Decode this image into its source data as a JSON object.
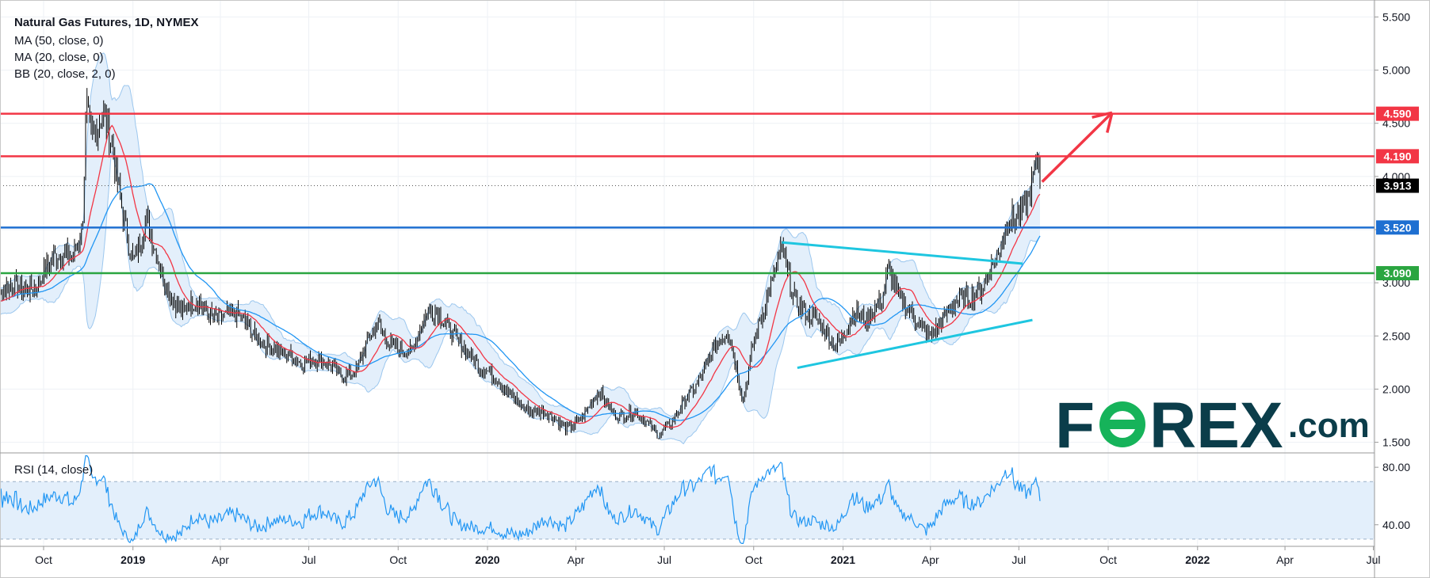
{
  "chart_data": [
    {
      "type": "candlestick",
      "title": "Natural Gas Futures, 1D, NYMEX",
      "legend": [
        "MA (50, close, 0)",
        "MA (20, close, 0)",
        "BB (20, close, 2, 0)"
      ],
      "ylim": [
        1.4,
        5.6
      ],
      "y_ticks": [
        "1.500",
        "2.000",
        "2.500",
        "3.000",
        "3.500",
        "4.000",
        "4.500",
        "5.000",
        "5.500"
      ],
      "x_ticks": [
        {
          "label": "Oct",
          "bold": false
        },
        {
          "label": "2019",
          "bold": true
        },
        {
          "label": "Apr",
          "bold": false
        },
        {
          "label": "Jul",
          "bold": false
        },
        {
          "label": "Oct",
          "bold": false
        },
        {
          "label": "2020",
          "bold": true
        },
        {
          "label": "Apr",
          "bold": false
        },
        {
          "label": "Jul",
          "bold": false
        },
        {
          "label": "Oct",
          "bold": false
        },
        {
          "label": "2021",
          "bold": true
        },
        {
          "label": "Apr",
          "bold": false
        },
        {
          "label": "Jul",
          "bold": false
        },
        {
          "label": "Oct",
          "bold": false
        },
        {
          "label": "2022",
          "bold": true
        },
        {
          "label": "Apr",
          "bold": false
        },
        {
          "label": "Jul",
          "bold": false
        }
      ],
      "price_path": [
        [
          "2018-08-01",
          2.85
        ],
        [
          "2018-08-20",
          2.9
        ],
        [
          "2018-09-10",
          2.95
        ],
        [
          "2018-09-25",
          3.05
        ],
        [
          "2018-10-15",
          3.2
        ],
        [
          "2018-11-01",
          3.3
        ],
        [
          "2018-11-10",
          3.6
        ],
        [
          "2018-11-14",
          4.7
        ],
        [
          "2018-11-20",
          4.3
        ],
        [
          "2018-12-01",
          4.5
        ],
        [
          "2018-12-10",
          4.3
        ],
        [
          "2018-12-20",
          3.8
        ],
        [
          "2019-01-01",
          3.2
        ],
        [
          "2019-01-15",
          3.5
        ],
        [
          "2019-02-01",
          3.1
        ],
        [
          "2019-02-20",
          2.7
        ],
        [
          "2019-03-10",
          2.8
        ],
        [
          "2019-04-01",
          2.7
        ],
        [
          "2019-05-01",
          2.6
        ],
        [
          "2019-06-01",
          2.3
        ],
        [
          "2019-07-01",
          2.3
        ],
        [
          "2019-08-01",
          2.15
        ],
        [
          "2019-08-20",
          2.2
        ],
        [
          "2019-09-10",
          2.6
        ],
        [
          "2019-09-25",
          2.45
        ],
        [
          "2019-10-15",
          2.3
        ],
        [
          "2019-11-01",
          2.75
        ],
        [
          "2019-11-10",
          2.8
        ],
        [
          "2019-12-01",
          2.4
        ],
        [
          "2020-01-01",
          2.2
        ],
        [
          "2020-01-20",
          1.95
        ],
        [
          "2020-02-10",
          1.85
        ],
        [
          "2020-03-01",
          1.75
        ],
        [
          "2020-03-20",
          1.65
        ],
        [
          "2020-04-10",
          1.75
        ],
        [
          "2020-04-25",
          1.95
        ],
        [
          "2020-05-10",
          1.8
        ],
        [
          "2020-06-01",
          1.75
        ],
        [
          "2020-06-25",
          1.6
        ],
        [
          "2020-07-15",
          1.75
        ],
        [
          "2020-08-01",
          2.0
        ],
        [
          "2020-08-20",
          2.4
        ],
        [
          "2020-09-05",
          2.5
        ],
        [
          "2020-09-20",
          1.9
        ],
        [
          "2020-10-01",
          2.5
        ],
        [
          "2020-10-20",
          2.95
        ],
        [
          "2020-10-30",
          3.3
        ],
        [
          "2020-11-10",
          2.95
        ],
        [
          "2020-11-25",
          2.7
        ],
        [
          "2020-12-10",
          2.55
        ],
        [
          "2020-12-25",
          2.45
        ],
        [
          "2021-01-10",
          2.7
        ],
        [
          "2021-01-25",
          2.6
        ],
        [
          "2021-02-10",
          2.9
        ],
        [
          "2021-02-17",
          3.2
        ],
        [
          "2021-03-01",
          2.8
        ],
        [
          "2021-03-20",
          2.6
        ],
        [
          "2021-04-01",
          2.55
        ],
        [
          "2021-04-20",
          2.7
        ],
        [
          "2021-05-10",
          2.9
        ],
        [
          "2021-05-25",
          3.0
        ],
        [
          "2021-06-10",
          3.2
        ],
        [
          "2021-06-20",
          3.6
        ],
        [
          "2021-06-30",
          3.7
        ],
        [
          "2021-07-10",
          3.8
        ],
        [
          "2021-07-20",
          4.1
        ],
        [
          "2021-07-23",
          3.91
        ]
      ],
      "horizontal_levels": [
        {
          "value": 4.59,
          "label": "4.590",
          "color": "#f23645"
        },
        {
          "value": 4.19,
          "label": "4.190",
          "color": "#f23645"
        },
        {
          "value": 3.52,
          "label": "3.520",
          "color": "#1e6fd1"
        },
        {
          "value": 3.09,
          "label": "3.090",
          "color": "#2aa540"
        }
      ],
      "last_price": {
        "value": 3.913,
        "label": "3.913"
      },
      "trendlines": [
        {
          "color": "#1ec6e0",
          "from": [
            "2020-10-30",
            3.38
          ],
          "to": [
            "2021-07-05",
            3.18
          ]
        },
        {
          "color": "#1ec6e0",
          "from": [
            "2020-11-15",
            2.2
          ],
          "to": [
            "2021-07-15",
            2.65
          ]
        }
      ],
      "arrow": {
        "color": "#f23645",
        "from": [
          "2021-07-25",
          3.95
        ],
        "to": [
          "2021-10-05",
          4.6
        ]
      },
      "colors": {
        "ma50": "#2196f3",
        "ma20": "#f23645",
        "bb_fill": "#e3effb",
        "bb_line": "#9cc7ee",
        "candles": "#000000"
      }
    },
    {
      "type": "line",
      "title": "RSI (14, close)",
      "ylim": [
        25,
        90
      ],
      "y_ticks": [
        "40.00",
        "80.00"
      ],
      "bands": [
        30,
        70
      ],
      "colors": {
        "line": "#2196f3",
        "band": "#e3effb"
      }
    }
  ],
  "brand": {
    "part1": "F",
    "part2": "REX",
    "suffix": ".com",
    "colors": {
      "text": "#0b3d4a",
      "accent": "#16b35a"
    }
  }
}
